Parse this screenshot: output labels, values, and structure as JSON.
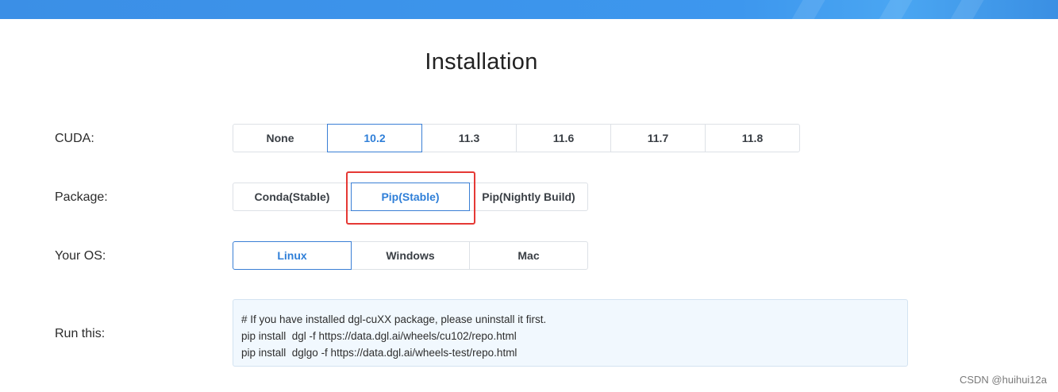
{
  "page": {
    "title": "Installation"
  },
  "rows": {
    "cuda": {
      "label": "CUDA:",
      "options": [
        "None",
        "10.2",
        "11.3",
        "11.6",
        "11.7",
        "11.8"
      ],
      "selected": "10.2"
    },
    "package": {
      "label": "Package:",
      "options": [
        "Conda(Stable)",
        "Pip(Stable)",
        "Pip(Nightly Build)"
      ],
      "selected": "Pip(Stable)"
    },
    "os": {
      "label": "Your OS:",
      "options": [
        "Linux",
        "Windows",
        "Mac"
      ],
      "selected": "Linux"
    },
    "run": {
      "label": "Run this:",
      "lines": [
        "# If you have installed dgl-cuXX package, please uninstall it first.",
        "pip install  dgl -f https://data.dgl.ai/wheels/cu102/repo.html",
        "pip install  dglgo -f https://data.dgl.ai/wheels-test/repo.html"
      ]
    }
  },
  "colors": {
    "accent": "#2f7fd8",
    "highlight": "#e53935",
    "banner": "#3d97ee",
    "code_bg": "#f1f8fe"
  },
  "watermark": "CSDN @huihui12a"
}
